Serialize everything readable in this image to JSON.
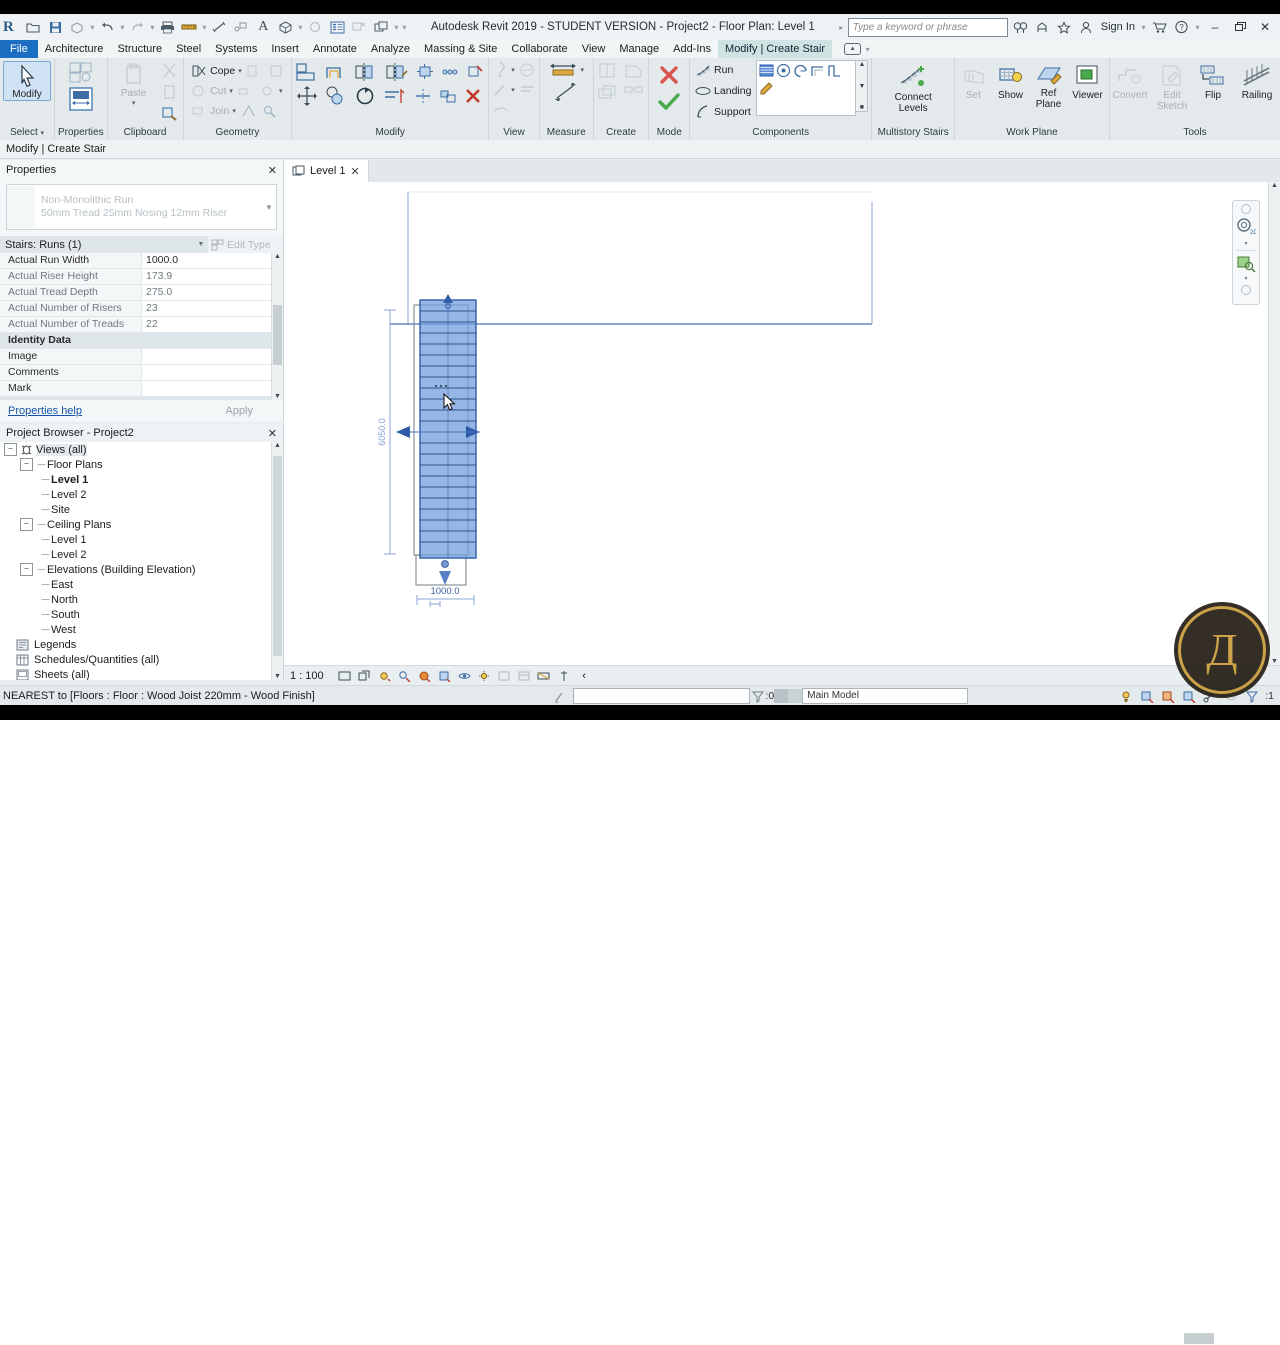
{
  "window": {
    "title": "Autodesk Revit 2019 - STUDENT VERSION - Project2 - Floor Plan: Level 1",
    "logo": "R",
    "search_placeholder": "Type a keyword or phrase",
    "sign_in": "Sign In",
    "minimize": "–",
    "restore": "❐",
    "close": "✕",
    "help": "?"
  },
  "quick_access": [
    {
      "name": "open-icon",
      "glyph": "open"
    },
    {
      "name": "save-icon",
      "glyph": "save"
    },
    {
      "name": "save-as-icon",
      "glyph": "saveas"
    },
    {
      "name": "undo-icon",
      "glyph": "undo"
    },
    {
      "name": "redo-icon",
      "glyph": "redo"
    },
    {
      "name": "print-icon",
      "glyph": "print"
    },
    {
      "name": "measure-icon",
      "glyph": "measure"
    },
    {
      "name": "aligned-dimension-icon",
      "glyph": "dim"
    },
    {
      "name": "tag-icon",
      "glyph": "tag"
    },
    {
      "name": "text-icon",
      "glyph": "A"
    },
    {
      "name": "default-3d-view-icon",
      "glyph": "3d"
    },
    {
      "name": "section-icon",
      "glyph": "section"
    },
    {
      "name": "thin-lines-icon",
      "glyph": "thin"
    },
    {
      "name": "close-hidden-windows-icon",
      "glyph": "closehidden"
    },
    {
      "name": "switch-windows-icon",
      "glyph": "switch"
    }
  ],
  "tabs": [
    {
      "label": "File",
      "kind": "file"
    },
    {
      "label": "Architecture",
      "kind": "normal"
    },
    {
      "label": "Structure",
      "kind": "normal"
    },
    {
      "label": "Steel",
      "kind": "normal"
    },
    {
      "label": "Systems",
      "kind": "normal"
    },
    {
      "label": "Insert",
      "kind": "normal"
    },
    {
      "label": "Annotate",
      "kind": "normal"
    },
    {
      "label": "Analyze",
      "kind": "normal"
    },
    {
      "label": "Massing & Site",
      "kind": "normal"
    },
    {
      "label": "Collaborate",
      "kind": "normal"
    },
    {
      "label": "View",
      "kind": "normal"
    },
    {
      "label": "Manage",
      "kind": "normal"
    },
    {
      "label": "Add-Ins",
      "kind": "normal"
    },
    {
      "label": "Modify | Create Stair",
      "kind": "ctx"
    }
  ],
  "ribbon": {
    "panels": [
      {
        "title": "Select",
        "buttons": [
          {
            "label": "Modify",
            "name": "modify-button",
            "state": "selected"
          }
        ],
        "has_dropdown": true
      },
      {
        "title": "Properties",
        "buttons": [
          {
            "label": "",
            "name": "properties-type-button",
            "state": "normal"
          },
          {
            "label": "",
            "name": "properties-button",
            "state": "active"
          }
        ]
      },
      {
        "title": "Clipboard",
        "buttons": [
          {
            "label": "Paste",
            "name": "paste-button",
            "state": "disabled"
          }
        ],
        "small": [
          {
            "label": "",
            "name": "cut-icon",
            "state": "disabled"
          },
          {
            "label": "",
            "name": "copy-icon",
            "state": "disabled"
          },
          {
            "label": "",
            "name": "match-type-properties-icon",
            "state": "normal"
          }
        ]
      },
      {
        "title": "Geometry",
        "small": [
          {
            "label": "Cope",
            "name": "cope-button",
            "state": "normal"
          },
          {
            "label": "Cut",
            "name": "cut-button",
            "state": "disabled"
          },
          {
            "label": "Join",
            "name": "join-button",
            "state": "disabled"
          }
        ]
      },
      {
        "title": "Modify",
        "small": [
          {
            "label": "",
            "name": "align-icon",
            "state": "normal"
          },
          {
            "label": "",
            "name": "offset-icon",
            "state": "normal"
          },
          {
            "label": "",
            "name": "mirror-pick-axis-icon",
            "state": "normal"
          },
          {
            "label": "",
            "name": "mirror-draw-axis-icon",
            "state": "normal"
          },
          {
            "label": "",
            "name": "move-icon",
            "state": "normal"
          },
          {
            "label": "",
            "name": "copy-icon",
            "state": "normal"
          },
          {
            "label": "",
            "name": "rotate-icon",
            "state": "normal"
          },
          {
            "label": "",
            "name": "trim-extend-icon",
            "state": "normal"
          },
          {
            "label": "",
            "name": "split-element-icon",
            "state": "normal"
          },
          {
            "label": "",
            "name": "array-icon",
            "state": "normal"
          },
          {
            "label": "",
            "name": "scale-icon",
            "state": "normal"
          },
          {
            "label": "",
            "name": "pin-icon",
            "state": "normal"
          },
          {
            "label": "",
            "name": "unpin-icon",
            "state": "normal"
          },
          {
            "label": "",
            "name": "delete-icon",
            "state": "normal"
          }
        ]
      },
      {
        "title": "View",
        "small": [
          {
            "label": "",
            "name": "hide-element-icon",
            "state": "disabled"
          },
          {
            "label": "",
            "name": "override-graphics-icon",
            "state": "disabled"
          },
          {
            "label": "",
            "name": "linework-icon",
            "state": "disabled"
          },
          {
            "label": "",
            "name": "reveal-hidden-icon",
            "state": "disabled"
          }
        ]
      },
      {
        "title": "Measure",
        "small": [
          {
            "label": "",
            "name": "measure-between-references-icon",
            "state": "normal"
          },
          {
            "label": "",
            "name": "measure-along-element-icon",
            "state": "normal"
          }
        ]
      },
      {
        "title": "Create",
        "small": [
          {
            "label": "",
            "name": "create-similar-icon",
            "state": "disabled"
          },
          {
            "label": "",
            "name": "edit-family-icon",
            "state": "disabled"
          },
          {
            "label": "",
            "name": "create-group-icon",
            "state": "disabled"
          },
          {
            "label": "",
            "name": "create-part-icon",
            "state": "disabled"
          }
        ]
      },
      {
        "title": "Mode",
        "buttons": [
          {
            "label": "",
            "name": "cancel-mode-button",
            "state": "normal"
          },
          {
            "label": "",
            "name": "finish-mode-button",
            "state": "normal"
          }
        ]
      },
      {
        "title": "Components",
        "small": [
          {
            "label": "Run",
            "name": "run-button",
            "state": "normal"
          },
          {
            "label": "Landing",
            "name": "landing-button",
            "state": "normal"
          },
          {
            "label": "Support",
            "name": "support-button",
            "state": "normal"
          }
        ],
        "gallery": [
          {
            "name": "straight-run-icon"
          },
          {
            "name": "full-step-spiral-icon"
          },
          {
            "name": "center-ends-spiral-icon"
          },
          {
            "name": "l-shape-winder-icon"
          },
          {
            "name": "u-shape-winder-icon"
          },
          {
            "name": "create-sketch-icon"
          }
        ]
      },
      {
        "title": "Multistory Stairs",
        "buttons": [
          {
            "label": "Connect\nLevels",
            "name": "connect-levels-button",
            "state": "normal"
          }
        ]
      },
      {
        "title": "Work Plane",
        "buttons": [
          {
            "label": "Set",
            "name": "set-workplane-button",
            "state": "disabled"
          },
          {
            "label": "Show",
            "name": "show-workplane-button",
            "state": "normal"
          },
          {
            "label": "Ref\nPlane",
            "name": "ref-plane-button",
            "state": "normal"
          },
          {
            "label": "Viewer",
            "name": "viewer-button",
            "state": "normal"
          }
        ]
      },
      {
        "title": "Tools",
        "buttons": [
          {
            "label": "Convert",
            "name": "convert-button",
            "state": "disabled"
          },
          {
            "label": "Edit\nSketch",
            "name": "edit-sketch-button",
            "state": "disabled"
          },
          {
            "label": "Flip",
            "name": "flip-button",
            "state": "normal"
          },
          {
            "label": "Railing",
            "name": "railing-button",
            "state": "normal"
          }
        ]
      }
    ]
  },
  "context_strip": {
    "label": "Modify | Create Stair"
  },
  "properties": {
    "title": "Properties",
    "close": "✕",
    "type_line1": "Non-Monolithic Run",
    "type_line2": "50mm Tread 25mm Nosing 12mm Riser",
    "selector_label": "Stairs: Runs (1)",
    "edit_type_label": "Edit Type",
    "rows": [
      {
        "key": "Actual Run Width",
        "value": "1000.0",
        "dim": false
      },
      {
        "key": "Actual Riser Height",
        "value": "173.9",
        "dim": true
      },
      {
        "key": "Actual Tread Depth",
        "value": "275.0",
        "dim": true
      },
      {
        "key": "Actual Number of Risers",
        "value": "23",
        "dim": true
      },
      {
        "key": "Actual Number of Treads",
        "value": "22",
        "dim": true
      },
      {
        "key": "Identity Data",
        "value": "",
        "group": true
      },
      {
        "key": "Image",
        "value": "",
        "dim": false
      },
      {
        "key": "Comments",
        "value": "",
        "dim": false
      },
      {
        "key": "Mark",
        "value": "",
        "dim": false
      }
    ],
    "help_link": "Properties help",
    "apply_label": "Apply"
  },
  "project_browser": {
    "title": "Project Browser - Project2",
    "close": "✕",
    "nodes": [
      {
        "label": "Views (all)",
        "depth": 0,
        "expander": "−",
        "icon": "views-icon",
        "selected": true
      },
      {
        "label": "Floor Plans",
        "depth": 1,
        "expander": "−"
      },
      {
        "label": "Level 1",
        "depth": 2,
        "bold": true
      },
      {
        "label": "Level 2",
        "depth": 2
      },
      {
        "label": "Site",
        "depth": 2
      },
      {
        "label": "Ceiling Plans",
        "depth": 1,
        "expander": "−"
      },
      {
        "label": "Level 1",
        "depth": 2
      },
      {
        "label": "Level 2",
        "depth": 2
      },
      {
        "label": "Elevations (Building Elevation)",
        "depth": 1,
        "expander": "−"
      },
      {
        "label": "East",
        "depth": 2
      },
      {
        "label": "North",
        "depth": 2
      },
      {
        "label": "South",
        "depth": 2
      },
      {
        "label": "West",
        "depth": 2
      },
      {
        "label": "Legends",
        "depth": 1,
        "icon": "legends-icon"
      },
      {
        "label": "Schedules/Quantities (all)",
        "depth": 1,
        "icon": "schedules-icon"
      },
      {
        "label": "Sheets (all)",
        "depth": 1,
        "icon": "sheets-icon"
      }
    ]
  },
  "view": {
    "tab_label": "Level 1",
    "tab_close": "✕",
    "scale": "1 : 100",
    "drawing": {
      "vertical_dimension": "6050.0",
      "horizontal_dimension": "1000.0",
      "riser_count": 23,
      "run_fill_color": "#5b8ed6",
      "run_outline_color": "#2f5ca8",
      "level_line_color": "#8aa7d6"
    }
  },
  "view_controls": {
    "icons": [
      {
        "name": "detail-level-icon"
      },
      {
        "name": "visual-style-icon"
      },
      {
        "name": "sun-path-icon"
      },
      {
        "name": "shadows-icon"
      },
      {
        "name": "rendering-dialog-icon"
      },
      {
        "name": "crop-view-icon"
      },
      {
        "name": "show-crop-region-icon"
      },
      {
        "name": "temporary-hide-isolate-icon"
      },
      {
        "name": "reveal-hidden-elements-icon"
      },
      {
        "name": "temporary-view-properties-icon"
      },
      {
        "name": "analytical-model-icon"
      },
      {
        "name": "constraints-icon"
      },
      {
        "name": "expand-icon"
      }
    ]
  },
  "status_bar": {
    "message": "NEAREST  to [Floors : Floor : Wood Joist 220mm - Wood Finish]",
    "filter_count": ":0",
    "workset": "Main Model",
    "filter_badge": ":1",
    "right_icons": [
      {
        "name": "editable-only-icon"
      },
      {
        "name": "design-option-icon"
      },
      {
        "name": "worksets-icon"
      },
      {
        "name": "exclude-options-icon"
      },
      {
        "name": "select-links-icon"
      },
      {
        "name": "select-underlay-icon"
      },
      {
        "name": "filter-icon"
      }
    ]
  }
}
